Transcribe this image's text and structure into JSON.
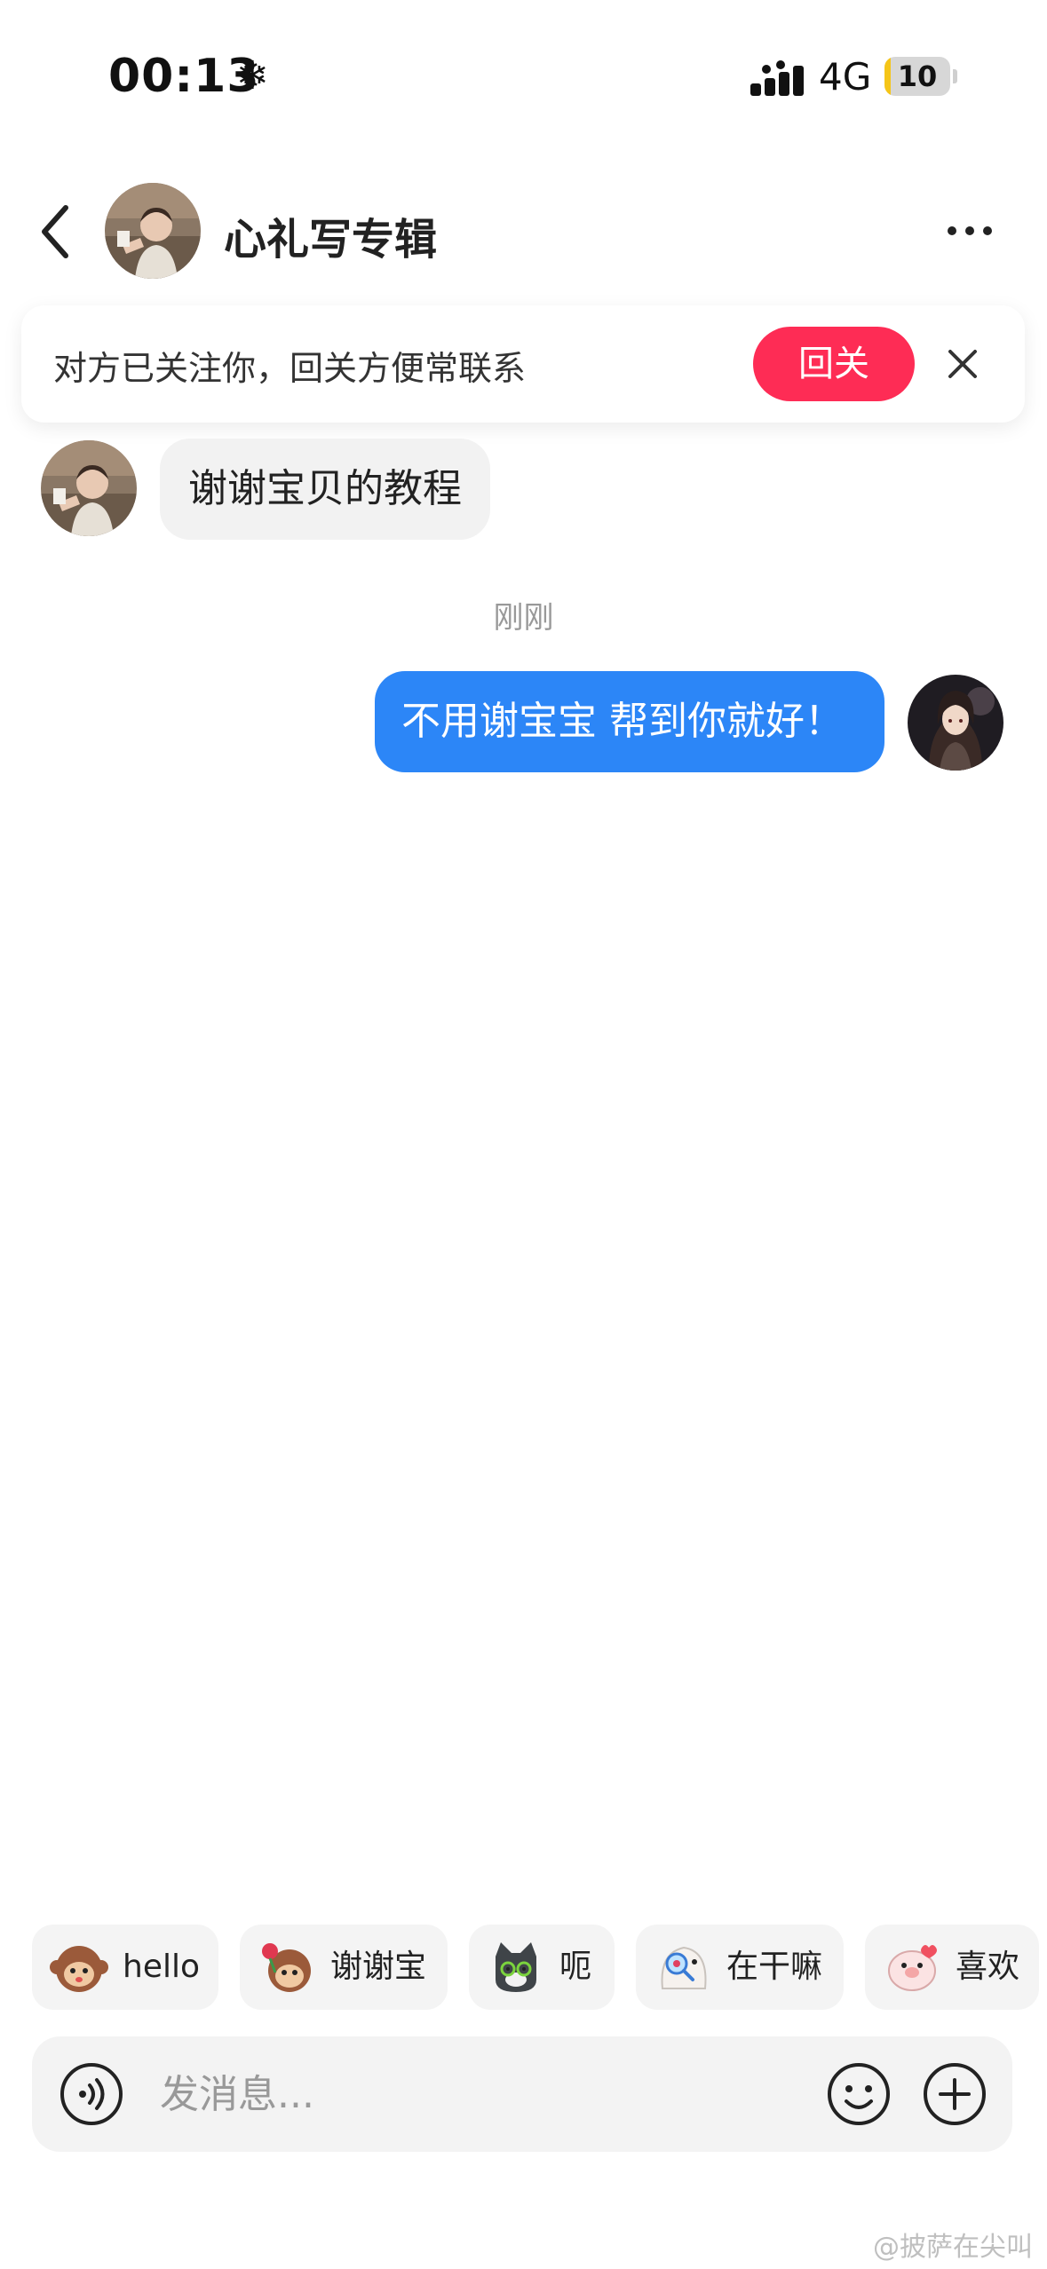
{
  "status_bar": {
    "time": "00:13",
    "network": "4G",
    "battery": "10",
    "battery_level": 0.1
  },
  "header": {
    "contact_name": "心礼写专辑"
  },
  "follow_banner": {
    "text": "对方已关注你，回关方便常联系",
    "button": "回关"
  },
  "messages": [
    {
      "direction": "incoming",
      "text": "谢谢宝贝的教程"
    },
    {
      "direction": "timestamp",
      "text": "刚刚"
    },
    {
      "direction": "outgoing",
      "text": "不用谢宝宝 帮到你就好！"
    }
  ],
  "quick_replies": [
    {
      "label": "hello",
      "icon": "monkey-wave-sticker"
    },
    {
      "label": "谢谢宝",
      "icon": "monkey-rose-sticker"
    },
    {
      "label": "呃",
      "icon": "cat-glasses-sticker"
    },
    {
      "label": "在干嘛",
      "icon": "blob-magnifier-sticker"
    },
    {
      "label": "喜欢",
      "icon": "pig-heart-sticker"
    }
  ],
  "composer": {
    "placeholder": "发消息..."
  },
  "watermark": "@披萨在尖叫",
  "colors": {
    "follow_button": "#fe2c55",
    "outgoing_bubble": "#2c86f7",
    "incoming_bubble": "#f2f2f2",
    "battery_fill": "#f5c518"
  }
}
